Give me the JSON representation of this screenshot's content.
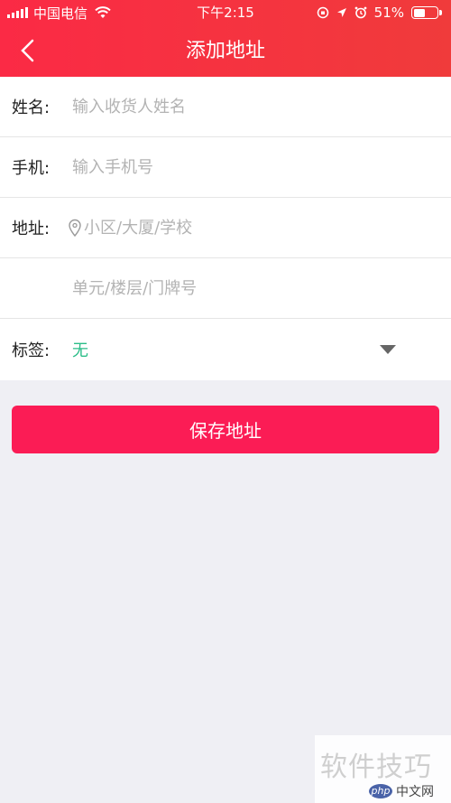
{
  "status_bar": {
    "carrier": "中国电信",
    "time": "下午2:15",
    "battery": "51%",
    "battery_level": 0.51,
    "icons": [
      "signal-icon",
      "wifi-icon",
      "screen-lock-icon",
      "location-icon",
      "alarm-icon",
      "battery-icon"
    ]
  },
  "header": {
    "title": "添加地址",
    "back_icon": "chevron-left-icon",
    "background_color": "#fb2a45"
  },
  "form": {
    "name": {
      "label": "姓名:",
      "placeholder": "输入收货人姓名",
      "value": ""
    },
    "phone": {
      "label": "手机:",
      "placeholder": "输入手机号",
      "value": ""
    },
    "address": {
      "label": "地址:",
      "placeholder": "小区/大厦/学校",
      "value": "",
      "icon": "location-pin-icon"
    },
    "address_detail": {
      "placeholder": "单元/楼层/门牌号",
      "value": ""
    },
    "tag": {
      "label": "标签:",
      "value": "无",
      "value_color": "#2bbd88",
      "dropdown_icon": "caret-down-icon"
    }
  },
  "actions": {
    "save_label": "保存地址",
    "save_color": "#fb1c55"
  },
  "watermark": {
    "text": "软件技巧",
    "badge": "php",
    "site": "中文网"
  }
}
